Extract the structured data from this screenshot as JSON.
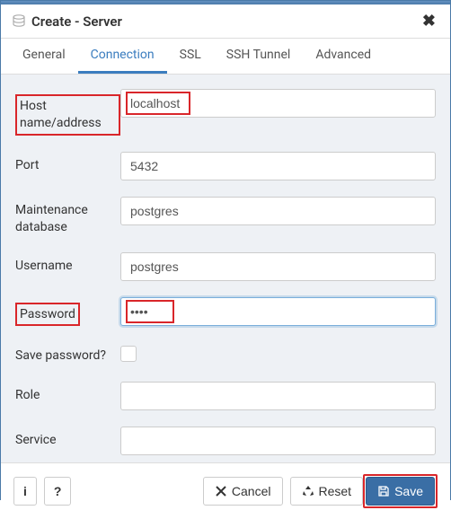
{
  "header": {
    "title": "Create - Server"
  },
  "tabs": {
    "general": "General",
    "connection": "Connection",
    "ssl": "SSL",
    "ssh": "SSH Tunnel",
    "advanced": "Advanced"
  },
  "form": {
    "host": {
      "label": "Host name/address",
      "value": "localhost"
    },
    "port": {
      "label": "Port",
      "value": "5432"
    },
    "maintdb": {
      "label": "Maintenance database",
      "value": "postgres"
    },
    "username": {
      "label": "Username",
      "value": "postgres"
    },
    "password": {
      "label": "Password",
      "value": "••••"
    },
    "savepw": {
      "label": "Save password?"
    },
    "role": {
      "label": "Role",
      "value": ""
    },
    "service": {
      "label": "Service",
      "value": ""
    }
  },
  "buttons": {
    "cancel": "Cancel",
    "reset": "Reset",
    "save": "Save",
    "info": "i",
    "help": "?"
  },
  "highlight_color": "#d9262a"
}
